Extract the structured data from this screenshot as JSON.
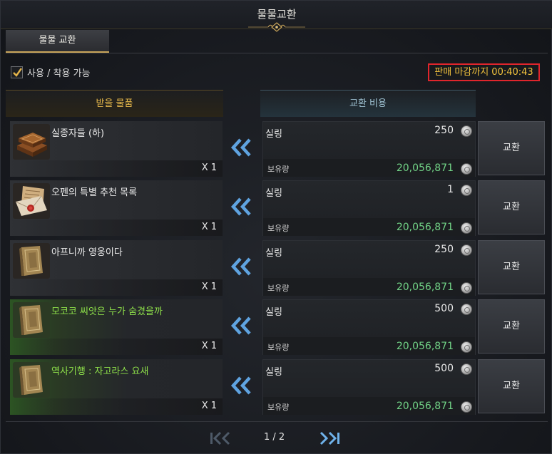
{
  "window": {
    "title": "물물교환"
  },
  "tabs": [
    {
      "label": "물물 교환",
      "active": true
    }
  ],
  "filter": {
    "checkbox_label": "사용 / 착용 가능",
    "checked": true
  },
  "deadline": {
    "text": "판매 마감까지 00:40:43"
  },
  "headers": {
    "receive": "받을 물품",
    "cost": "교환 비용"
  },
  "rows": [
    {
      "item_name": "실종자들 (하)",
      "item_name_color": "#ececec",
      "icon": "book-bundle-icon",
      "quantity": "X 1",
      "currency": "실링",
      "price": "250",
      "owned_label": "보유량",
      "owned_amount": "20,056,871",
      "button_label": "교환"
    },
    {
      "item_name": "오펜의 특별 추천 목록",
      "item_name_color": "#ececec",
      "icon": "sealed-letter-icon",
      "quantity": "X 1",
      "currency": "실링",
      "price": "1",
      "owned_label": "보유량",
      "owned_amount": "20,056,871",
      "button_label": "교환"
    },
    {
      "item_name": "아프니까 영웅이다",
      "item_name_color": "#ececec",
      "icon": "book-icon",
      "quantity": "X 1",
      "currency": "실링",
      "price": "250",
      "owned_label": "보유량",
      "owned_amount": "20,056,871",
      "button_label": "교환"
    },
    {
      "item_name": "모코코 씨앗은 누가 숨겼을까",
      "item_name_color": "#8fe24a",
      "icon": "book-icon",
      "quantity": "X 1",
      "currency": "실링",
      "price": "500",
      "owned_label": "보유량",
      "owned_amount": "20,056,871",
      "button_label": "교환"
    },
    {
      "item_name": "역사기행 : 자고라스 요새",
      "item_name_color": "#8fe24a",
      "icon": "book-icon",
      "quantity": "X 1",
      "currency": "실링",
      "price": "500",
      "owned_label": "보유량",
      "owned_amount": "20,056,871",
      "button_label": "교환"
    }
  ],
  "pagination": {
    "text": "1 / 2",
    "first_icon": "first-page-icon",
    "last_icon": "last-page-icon"
  },
  "colors": {
    "accent_gold": "#c9a55a",
    "deadline_border": "#e0252c",
    "deadline_text": "#f2c23d",
    "owned_green": "#72d487",
    "arrow_blue": "#5fa3e0"
  }
}
